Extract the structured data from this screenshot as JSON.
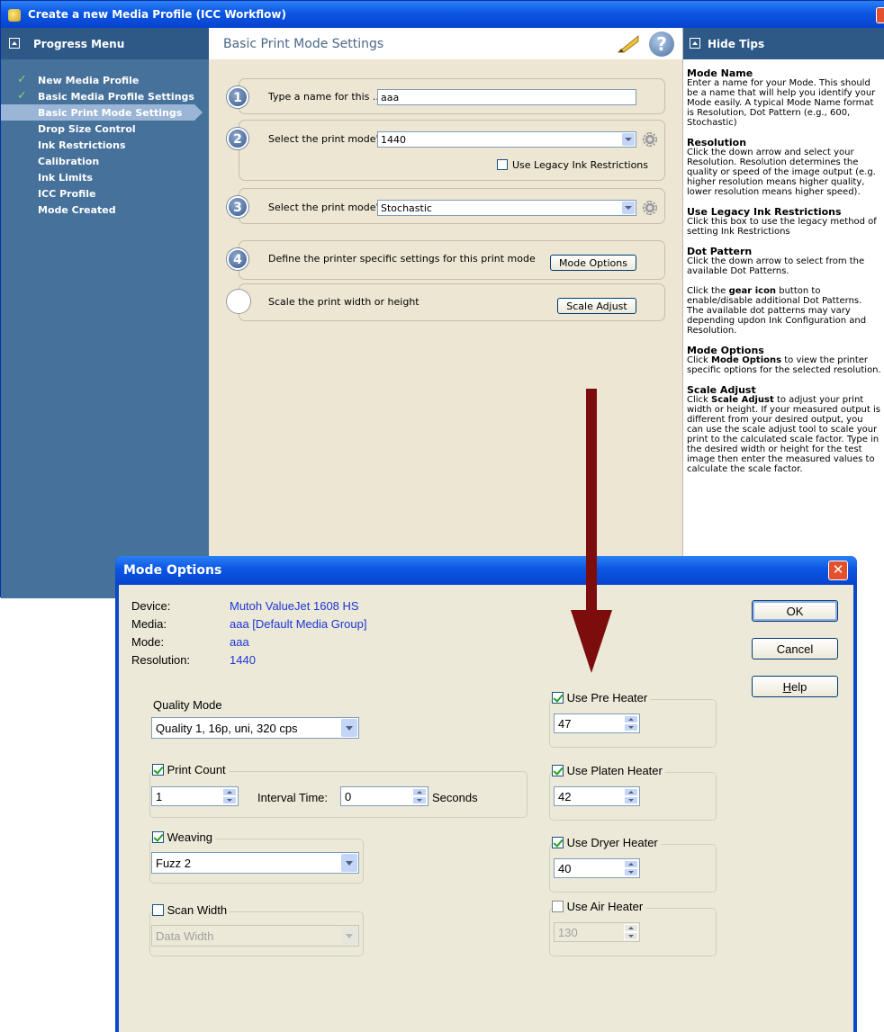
{
  "main_window": {
    "title": "Create a new Media Profile (ICC Workflow)"
  },
  "sidebar": {
    "header": "Progress Menu",
    "items": [
      {
        "label": "New Media Profile",
        "state": "done"
      },
      {
        "label": "Basic Media Profile Settings",
        "state": "done"
      },
      {
        "label": "Basic Print Mode Settings",
        "state": "active"
      },
      {
        "label": "Drop Size Control",
        "state": "todo"
      },
      {
        "label": "Ink Restrictions",
        "state": "todo"
      },
      {
        "label": "Calibration",
        "state": "todo"
      },
      {
        "label": "Ink Limits",
        "state": "todo"
      },
      {
        "label": "ICC Profile",
        "state": "todo"
      },
      {
        "label": "Mode Created",
        "state": "todo"
      }
    ]
  },
  "center": {
    "title": "Basic Print Mode Settings",
    "help_glyph": "?",
    "steps": [
      {
        "num": "1",
        "label": "Type a name for this ...",
        "input_value": "aaa"
      },
      {
        "num": "2",
        "label": "Select the print mode'...",
        "select_value": "1440",
        "checkbox_label": "Use Legacy Ink Restrictions",
        "checkbox_checked": false
      },
      {
        "num": "3",
        "label": "Select the print mode'...",
        "select_value": "Stochastic"
      },
      {
        "num": "4",
        "label": "Define the printer specific settings for this print mode",
        "button_label": "Mode Options"
      },
      {
        "num": "",
        "label": "Scale the print width or height",
        "button_label": "Scale Adjust"
      }
    ]
  },
  "tips": {
    "header": "Hide Tips",
    "sections": [
      {
        "title": "Mode Name",
        "text": "Enter a name for your Mode. This should be a name that will help you identify your Mode easily. A typical Mode Name format is Resolution, Dot Pattern (e.g., 600, Stochastic)"
      },
      {
        "title": "Resolution",
        "text": "Click the down arrow and select your Resolution. Resolution determines the quality or speed of the image output (e.g. higher resolution means higher quality, lower resolution means higher speed)."
      },
      {
        "title": "Use Legacy Ink Restrictions",
        "text": "Click this box to use the legacy method of setting Ink Restrictions"
      },
      {
        "title": "Dot Pattern",
        "text": "Click the down arrow to select from the available Dot Patterns."
      },
      {
        "title": "",
        "text_pre": "Click the ",
        "bold": "gear icon",
        "text_post": " button to enable/disable additional Dot Patterns. The available dot patterns may vary depending updon Ink Configuration and Resolution."
      },
      {
        "title": "Mode Options",
        "text_pre": "Click ",
        "bold": "Mode Options",
        "text_post": " to view the printer specific options for the selected resolution."
      },
      {
        "title": "Scale Adjust",
        "text_pre": "Click ",
        "bold": "Scale Adjust",
        "text_post": " to adjust your print width or height. If your measured output is different from your desired output, you can use the scale adjust tool to scale your print to the calculated scale factor. Type in the desired width or height for the test image then enter the measured values to calculate the scale factor."
      }
    ]
  },
  "dialog": {
    "title": "Mode Options",
    "info": [
      {
        "label": "Device:",
        "value": "Mutoh ValueJet 1608 HS"
      },
      {
        "label": "Media:",
        "value": "aaa [Default Media Group]"
      },
      {
        "label": "Mode:",
        "value": "aaa"
      },
      {
        "label": "Resolution:",
        "value": "1440"
      }
    ],
    "buttons": {
      "ok": "OK",
      "cancel": "Cancel",
      "help_underlined": "H",
      "help_rest": "elp"
    },
    "quality_mode": {
      "label": "Quality Mode",
      "value": "Quality 1, 16p, uni, 320 cps"
    },
    "print_count": {
      "label": "Print Count",
      "checked": true,
      "value": "1",
      "interval_label": "Interval Time:",
      "interval_value": "0",
      "unit": "Seconds"
    },
    "weaving": {
      "label": "Weaving",
      "checked": true,
      "value": "Fuzz 2"
    },
    "scan_width": {
      "label": "Scan Width",
      "checked": false,
      "value": "Data Width"
    },
    "heaters": [
      {
        "label": "Use Pre Heater",
        "checked": true,
        "value": "47"
      },
      {
        "label": "Use Platen Heater",
        "checked": true,
        "value": "42"
      },
      {
        "label": "Use Dryer Heater",
        "checked": true,
        "value": "40"
      },
      {
        "label": "Use Air Heater",
        "checked": false,
        "value": "130"
      }
    ]
  },
  "colors": {
    "title_bar": "#0b56e3",
    "sidebar_bg": "#46719a",
    "panel_bg": "#ece6d2",
    "arrow": "#7d0c0c",
    "info_value": "#1c36d6"
  }
}
